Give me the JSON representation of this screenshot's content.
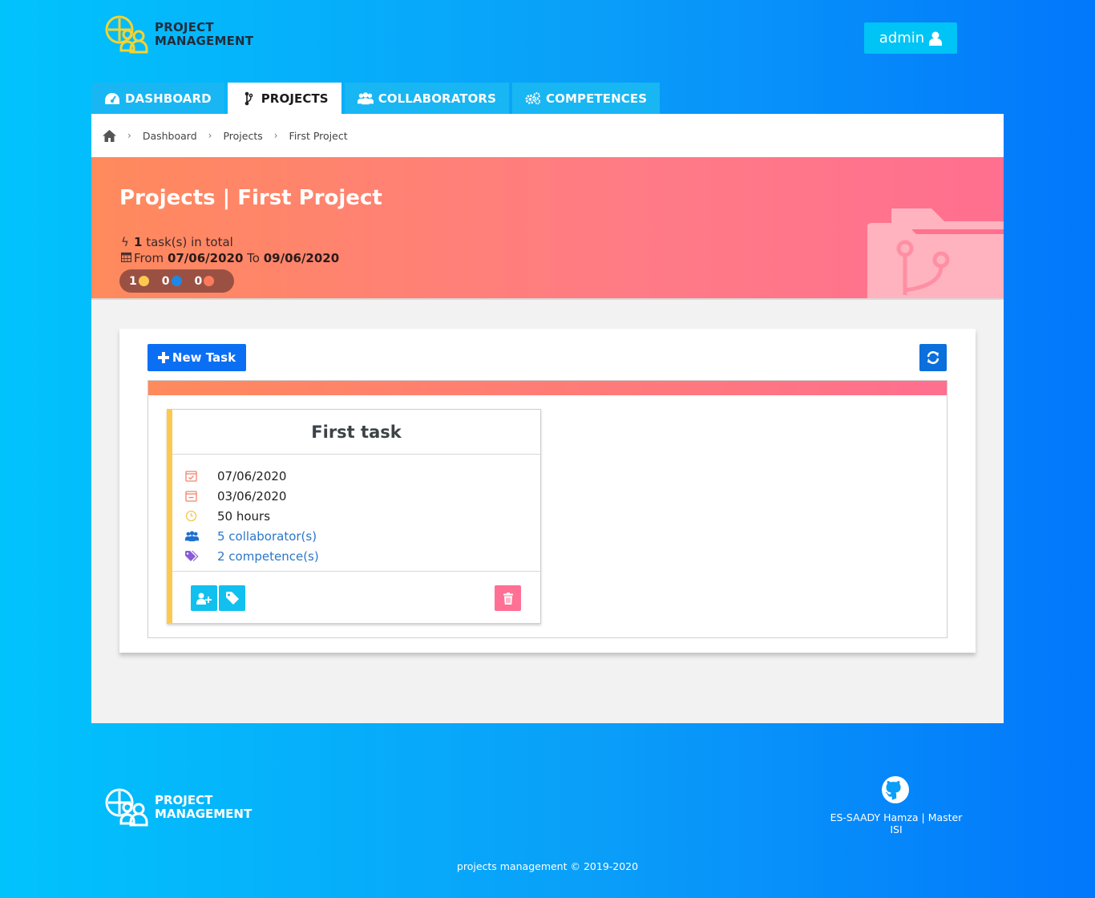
{
  "brand": {
    "line1": "PROJECT",
    "line2": "MANAGEMENT"
  },
  "user": {
    "name": "admin"
  },
  "tabs": [
    {
      "label": "DASHBOARD",
      "icon": "dashboard-gauge-icon"
    },
    {
      "label": "PROJECTS",
      "icon": "code-branch-icon",
      "active": true
    },
    {
      "label": "COLLABORATORS",
      "icon": "users-icon"
    },
    {
      "label": "COMPETENCES",
      "icon": "cogs-icon"
    }
  ],
  "breadcrumb": {
    "home_icon": "home-icon",
    "items": [
      "Dashboard",
      "Projects",
      "First Project"
    ],
    "separator": "›"
  },
  "project": {
    "title": "Projects | First Project",
    "task_count": "1",
    "task_count_suffix": " task(s) in total",
    "from_label": "From ",
    "from_date": "07/06/2020",
    "to_label": " To ",
    "to_date": "09/06/2020",
    "status_counts": [
      {
        "value": "1",
        "color": "#fcc94e"
      },
      {
        "value": "0",
        "color": "#1e88e5"
      },
      {
        "value": "0",
        "color": "#ff7a5c"
      }
    ]
  },
  "toolbar": {
    "new_task_label": "New Task",
    "refresh_icon": "refresh-icon"
  },
  "task": {
    "title": "First task",
    "end_date": "07/06/2020",
    "start_date": "03/06/2020",
    "duration": "50 hours",
    "collaborators_link": "5 collaborator(s)",
    "competences_link": "2 competence(s)"
  },
  "footer": {
    "author": "ES-SAADY Hamza | Master ISI",
    "copyright": "projects management © 2019-2020"
  },
  "colors": {
    "accent_blue": "#0b6ff4",
    "cyan": "#00c3f6",
    "delete_pink": "#ff6f8f",
    "task_border": "#fcc94e"
  }
}
